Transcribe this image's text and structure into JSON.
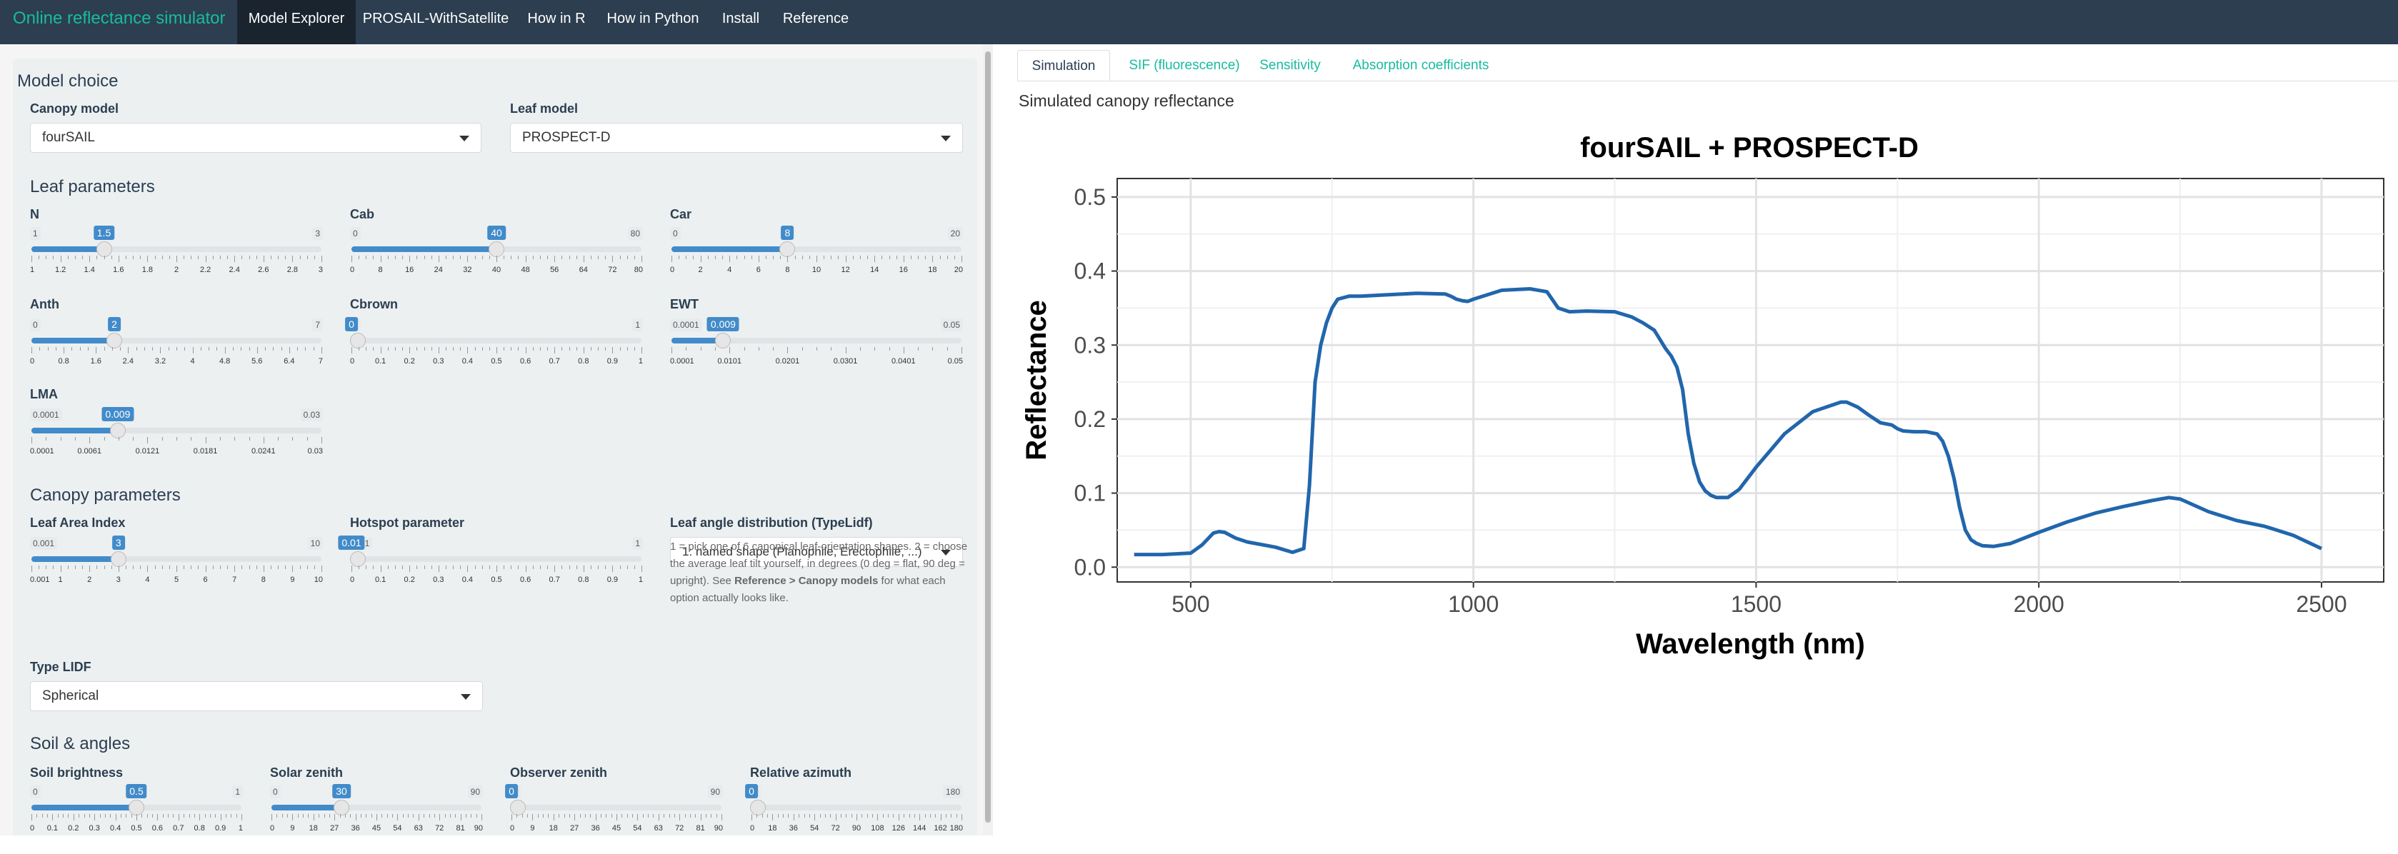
{
  "navbar": {
    "brand": "Online reflectance simulator",
    "items": [
      {
        "label": "Model Explorer",
        "active": true
      },
      {
        "label": "PROSAIL-WithSatellite",
        "active": false
      },
      {
        "label": "How in R",
        "active": false
      },
      {
        "label": "How in Python",
        "active": false
      },
      {
        "label": "Install",
        "active": false
      },
      {
        "label": "Reference",
        "active": false
      }
    ]
  },
  "model_choice": {
    "title": "Model choice",
    "canopy_label": "Canopy model",
    "canopy_value": "fourSAIL",
    "leaf_label": "Leaf model",
    "leaf_value": "PROSPECT-D"
  },
  "leaf_params": {
    "title": "Leaf parameters",
    "sliders": [
      {
        "label": "N",
        "min": "1",
        "max": "3",
        "value": "1.5",
        "frac": 0.25,
        "ticks": [
          "1",
          "1.2",
          "1.4",
          "1.6",
          "1.8",
          "2",
          "2.2",
          "2.4",
          "2.6",
          "2.8",
          "3"
        ]
      },
      {
        "label": "Cab",
        "min": "0",
        "max": "80",
        "value": "40",
        "frac": 0.5,
        "ticks": [
          "0",
          "8",
          "16",
          "24",
          "32",
          "40",
          "48",
          "56",
          "64",
          "72",
          "80"
        ]
      },
      {
        "label": "Car",
        "min": "0",
        "max": "20",
        "value": "8",
        "frac": 0.4,
        "ticks": [
          "0",
          "2",
          "4",
          "6",
          "8",
          "10",
          "12",
          "14",
          "16",
          "18",
          "20"
        ]
      },
      {
        "label": "Anth",
        "min": "0",
        "max": "7",
        "value": "2",
        "frac": 0.2857,
        "ticks": [
          "0",
          "0.8",
          "1.6",
          "2.4",
          "3.2",
          "4",
          "4.8",
          "5.6",
          "6.4",
          "7"
        ]
      },
      {
        "label": "Cbrown",
        "min": "0",
        "max": "1",
        "value": "0",
        "frac": 0.0,
        "ticks": [
          "0",
          "0.1",
          "0.2",
          "0.3",
          "0.4",
          "0.5",
          "0.6",
          "0.7",
          "0.8",
          "0.9",
          "1"
        ]
      },
      {
        "label": "EWT",
        "min": "0.0001",
        "max": "0.05",
        "value": "0.009",
        "frac": 0.1784,
        "ticks": [
          "0.0001",
          "0.0101",
          "0.0201",
          "0.0301",
          "0.0401",
          "0.05"
        ]
      },
      {
        "label": "LMA",
        "min": "0.0001",
        "max": "0.03",
        "value": "0.009",
        "frac": 0.2977,
        "ticks": [
          "0.0001",
          "0.0061",
          "0.0121",
          "0.0181",
          "0.0241",
          "0.03"
        ]
      }
    ]
  },
  "canopy_params": {
    "title": "Canopy parameters",
    "lai": {
      "label": "Leaf Area Index",
      "min": "0.001",
      "max": "10",
      "value": "3",
      "frac": 0.3,
      "ticks": [
        "0.001",
        "1",
        "2",
        "3",
        "4",
        "5",
        "6",
        "7",
        "8",
        "9",
        "10"
      ]
    },
    "hotspot": {
      "label": "Hotspot parameter",
      "min": "0.01",
      "max": "1",
      "value": "0.01",
      "frac": 0.0,
      "ticks": [
        "0",
        "0.1",
        "0.2",
        "0.3",
        "0.4",
        "0.5",
        "0.6",
        "0.7",
        "0.8",
        "0.9",
        "1"
      ]
    },
    "typelidf_label": "Leaf angle distribution (TypeLidf)",
    "typelidf_value": "1: named shape (Planophile, Erectophile, ...)",
    "help_text": "1 = pick one of 6 canonical leaf-orientation shapes. 2 = choose the average leaf tilt yourself, in degrees (0 deg = flat, 90 deg = upright). See ",
    "help_bold": "Reference > Canopy models",
    "help_after": " for what each option actually looks like.",
    "lidf_label": "Type LIDF",
    "lidf_value": "Spherical"
  },
  "soil_angles": {
    "title": "Soil & angles",
    "sliders": [
      {
        "label": "Soil brightness",
        "min": "0",
        "max": "1",
        "value": "0.5",
        "frac": 0.5,
        "ticks": [
          "0",
          "0.1",
          "0.2",
          "0.3",
          "0.4",
          "0.5",
          "0.6",
          "0.7",
          "0.8",
          "0.9",
          "1"
        ]
      },
      {
        "label": "Solar zenith",
        "min": "0",
        "max": "90",
        "value": "30",
        "frac": 0.3333,
        "ticks": [
          "0",
          "9",
          "18",
          "27",
          "36",
          "45",
          "54",
          "63",
          "72",
          "81",
          "90"
        ]
      },
      {
        "label": "Observer zenith",
        "min": "0",
        "max": "90",
        "value": "0",
        "frac": 0.0,
        "ticks": [
          "0",
          "9",
          "18",
          "27",
          "36",
          "45",
          "54",
          "63",
          "72",
          "81",
          "90"
        ]
      },
      {
        "label": "Relative azimuth",
        "min": "0",
        "max": "180",
        "value": "0",
        "frac": 0.0,
        "ticks": [
          "0",
          "18",
          "36",
          "54",
          "72",
          "90",
          "108",
          "126",
          "144",
          "162",
          "180"
        ]
      }
    ]
  },
  "tabs": [
    {
      "label": "Simulation",
      "active": true
    },
    {
      "label": "SIF (fluorescence)",
      "active": false
    },
    {
      "label": "Sensitivity",
      "active": false
    },
    {
      "label": "Absorption coefficients",
      "active": false
    }
  ],
  "output_title": "Simulated canopy reflectance",
  "colors": {
    "line": "#2166ac",
    "accent": "#18bc9c",
    "navbar": "#2c3e50",
    "slider": "#428bca"
  },
  "chart_data": {
    "type": "line",
    "title": "fourSAIL + PROSPECT-D",
    "xlabel": "Wavelength (nm)",
    "ylabel": "Reflectance",
    "xlim": [
      370,
      2610
    ],
    "ylim": [
      -0.02,
      0.525
    ],
    "xticks": [
      500,
      1000,
      1500,
      2000,
      2500
    ],
    "yticks": [
      0.0,
      0.1,
      0.2,
      0.3,
      0.4,
      0.5
    ],
    "ytick_labels": [
      "0.0",
      "0.1",
      "0.2",
      "0.3",
      "0.4",
      "0.5"
    ],
    "grid": true,
    "series": [
      {
        "x": [
          400,
          450,
          500,
          520,
          540,
          550,
          560,
          570,
          580,
          600,
          650,
          680,
          700,
          710,
          720,
          730,
          740,
          750,
          760,
          780,
          800,
          850,
          900,
          950,
          960,
          970,
          980,
          990,
          1000,
          1050,
          1100,
          1130,
          1150,
          1170,
          1200,
          1250,
          1280,
          1300,
          1320,
          1340,
          1350,
          1360,
          1370,
          1380,
          1390,
          1400,
          1410,
          1420,
          1430,
          1450,
          1470,
          1500,
          1550,
          1600,
          1650,
          1660,
          1680,
          1700,
          1720,
          1740,
          1750,
          1760,
          1780,
          1800,
          1820,
          1830,
          1840,
          1850,
          1860,
          1870,
          1880,
          1890,
          1900,
          1920,
          1950,
          2000,
          2050,
          2100,
          2150,
          2200,
          2230,
          2250,
          2300,
          2350,
          2400,
          2450,
          2500
        ],
        "y": [
          0.017,
          0.017,
          0.019,
          0.03,
          0.046,
          0.048,
          0.047,
          0.043,
          0.039,
          0.034,
          0.027,
          0.02,
          0.025,
          0.11,
          0.25,
          0.3,
          0.33,
          0.35,
          0.362,
          0.366,
          0.366,
          0.368,
          0.37,
          0.369,
          0.366,
          0.362,
          0.36,
          0.359,
          0.362,
          0.374,
          0.376,
          0.372,
          0.35,
          0.345,
          0.346,
          0.345,
          0.338,
          0.33,
          0.32,
          0.295,
          0.285,
          0.27,
          0.24,
          0.18,
          0.14,
          0.115,
          0.103,
          0.097,
          0.094,
          0.094,
          0.105,
          0.135,
          0.18,
          0.21,
          0.223,
          0.223,
          0.216,
          0.205,
          0.195,
          0.192,
          0.187,
          0.184,
          0.183,
          0.183,
          0.18,
          0.17,
          0.15,
          0.12,
          0.08,
          0.05,
          0.037,
          0.032,
          0.029,
          0.028,
          0.032,
          0.047,
          0.061,
          0.073,
          0.082,
          0.09,
          0.094,
          0.092,
          0.075,
          0.063,
          0.055,
          0.043,
          0.025
        ]
      }
    ]
  }
}
